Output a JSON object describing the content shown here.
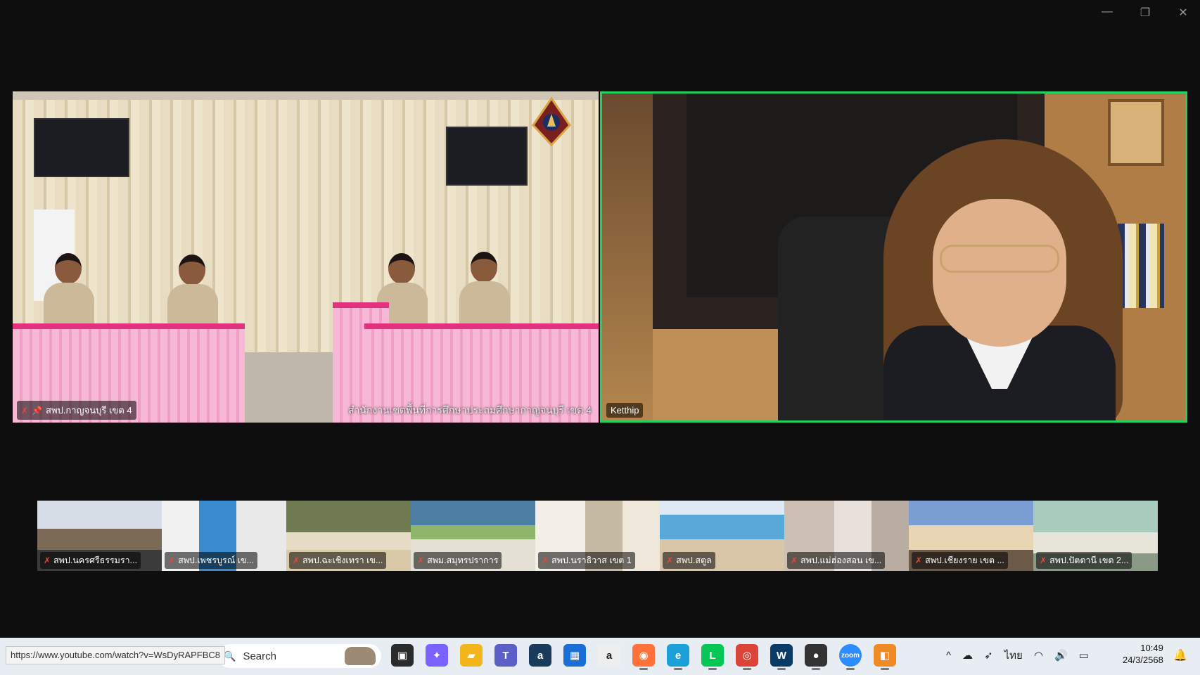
{
  "window": {
    "minimize_icon": "—",
    "restore_icon": "❐",
    "close_icon": "✕"
  },
  "main_tiles": [
    {
      "name": "สพป.กาญจนบุรี เขต 4",
      "muted": true,
      "pinned": true,
      "caption": "สำนักงานเขตพื้นที่การศึกษาประถมศึกษากาญจนบุรี เขต 4"
    },
    {
      "name": "Ketthip",
      "muted": false,
      "active_speaker": true,
      "border_color": "#23d160"
    }
  ],
  "thumbnails": [
    {
      "name": "สพป.นครศรีธรรมรา...",
      "muted": true
    },
    {
      "name": "สพป.เพชรบูรณ์ เข...",
      "muted": true
    },
    {
      "name": "สพป.ฉะเชิงเทรา เข...",
      "muted": true
    },
    {
      "name": "สพม.สมุทรปราการ",
      "muted": true
    },
    {
      "name": "สพป.นราธิวาส เขต 1",
      "muted": true
    },
    {
      "name": "สพป.สตูล",
      "muted": true
    },
    {
      "name": "สพป.แม่ฮ่องสอน เข...",
      "muted": true
    },
    {
      "name": "สพป.เชียงราย เขต ...",
      "muted": true
    },
    {
      "name": "สพป.ปัตตานี เขต 2...",
      "muted": true
    }
  ],
  "taskbar": {
    "url_tooltip": "https://www.youtube.com/watch?v=WsDyRAPFBC8",
    "search_placeholder": "Search",
    "apps": [
      {
        "icon": "task-view-icon",
        "glyph": "▣",
        "color": "#2b2b2b"
      },
      {
        "icon": "copilot-icon",
        "glyph": "✦",
        "color": "#7b61ff"
      },
      {
        "icon": "file-explorer-icon",
        "glyph": "▰",
        "color": "#f2b51c"
      },
      {
        "icon": "teams-icon",
        "glyph": "T",
        "color": "#5b5fc7"
      },
      {
        "icon": "amazon-shop-icon",
        "glyph": "a",
        "color": "#1b3b5a"
      },
      {
        "icon": "microsoft-store-icon",
        "glyph": "▦",
        "color": "#1a6fd6"
      },
      {
        "icon": "amazon-icon",
        "glyph": "a",
        "color": "#eeeeee"
      },
      {
        "icon": "firefox-icon",
        "glyph": "◉",
        "color": "#ff7139"
      },
      {
        "icon": "edge-icon",
        "glyph": "e",
        "color": "#1ba0d8"
      },
      {
        "icon": "line-icon",
        "glyph": "L",
        "color": "#06c755"
      },
      {
        "icon": "chrome-icon",
        "glyph": "◎",
        "color": "#db4437"
      },
      {
        "icon": "webex-icon",
        "glyph": "W",
        "color": "#0a3a66"
      },
      {
        "icon": "app-dark-icon",
        "glyph": "●",
        "color": "#333333"
      },
      {
        "icon": "zoom-icon",
        "glyph": "zoom",
        "color": "#2d8cff"
      },
      {
        "icon": "app-orange-icon",
        "glyph": "◧",
        "color": "#f08a24"
      }
    ],
    "tray": {
      "chevron": "^",
      "language": "ไทย"
    },
    "time": "10:49",
    "date": "24/3/2568"
  }
}
